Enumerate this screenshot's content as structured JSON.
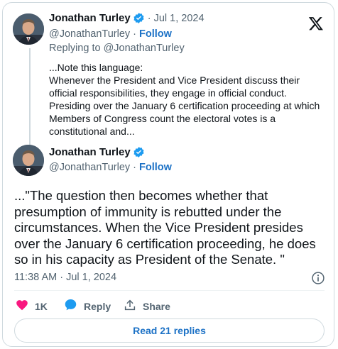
{
  "parent_tweet": {
    "author_name": "Jonathan Turley",
    "date": "Jul 1, 2024",
    "handle": "@JonathanTurley",
    "follow_label": "Follow",
    "replying_to": "Replying to @JonathanTurley",
    "text_lines": [
      "...Note this language:",
      "Whenever the President and Vice President discuss their",
      "official responsibilities, they engage in official conduct.",
      "Presiding over the January 6 certification proceeding at which",
      "Members of Congress count the electoral votes is a",
      "constitutional and..."
    ]
  },
  "main_tweet": {
    "author_name": "Jonathan Turley",
    "handle": "@JonathanTurley",
    "follow_label": "Follow",
    "text_lines": [
      "...\"The question then becomes whether that",
      "presumption of immunity is rebutted under the",
      "circumstances. When the Vice President presides",
      "over the January 6 certification proceeding, he does",
      "so in his capacity as President of the Senate. \""
    ],
    "timestamp": "11:38 AM · Jul 1, 2024"
  },
  "actions": {
    "like_count": "1K",
    "reply_label": "Reply",
    "share_label": "Share"
  },
  "read_replies_label": "Read 21 replies",
  "separator": "·",
  "colors": {
    "accent": "#1d9bf0",
    "like": "#f91880",
    "muted": "#536471",
    "text": "#0f1419"
  },
  "icons": [
    "verified-badge-icon",
    "x-logo-icon",
    "info-icon",
    "heart-icon",
    "reply-bubble-icon",
    "share-icon"
  ]
}
